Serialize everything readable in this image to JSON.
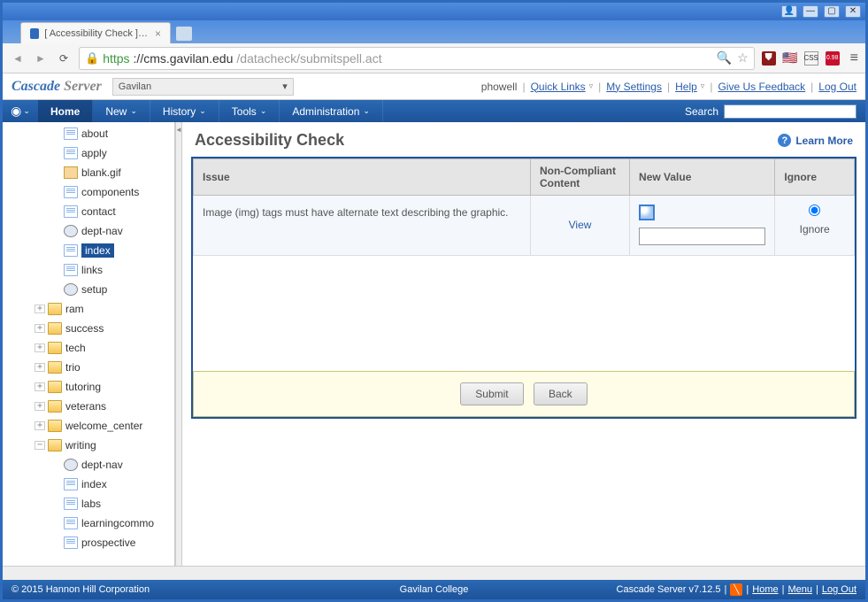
{
  "window": {
    "tab_title": "[ Accessibility Check ] Casca"
  },
  "browser": {
    "url_proto": "https",
    "url_host": "://cms.gavilan.edu",
    "url_path": "/datacheck/submitspell.act"
  },
  "logo": {
    "a": "Cascade",
    "b": " Server"
  },
  "site_selector": "Gavilan",
  "header_links": {
    "user": "phowell",
    "quick": "Quick Links",
    "settings": "My Settings",
    "help": "Help",
    "feedback": "Give Us Feedback",
    "logout": "Log Out"
  },
  "menubar": {
    "home": "Home",
    "new": "New",
    "history": "History",
    "tools": "Tools",
    "admin": "Administration",
    "search_label": "Search"
  },
  "sidebar": [
    {
      "d": 3,
      "exp": "",
      "icon": "page",
      "label": "about"
    },
    {
      "d": 3,
      "exp": "",
      "icon": "page",
      "label": "apply"
    },
    {
      "d": 3,
      "exp": "",
      "icon": "img",
      "label": "blank.gif"
    },
    {
      "d": 3,
      "exp": "",
      "icon": "page",
      "label": "components"
    },
    {
      "d": 3,
      "exp": "",
      "icon": "page",
      "label": "contact"
    },
    {
      "d": 3,
      "exp": "",
      "icon": "block",
      "label": "dept-nav"
    },
    {
      "d": 3,
      "exp": "",
      "icon": "page",
      "label": "index",
      "sel": true
    },
    {
      "d": 3,
      "exp": "",
      "icon": "page",
      "label": "links"
    },
    {
      "d": 3,
      "exp": "",
      "icon": "block",
      "label": "setup"
    },
    {
      "d": 2,
      "exp": "+",
      "icon": "folder",
      "label": "ram"
    },
    {
      "d": 2,
      "exp": "+",
      "icon": "folder",
      "label": "success"
    },
    {
      "d": 2,
      "exp": "+",
      "icon": "folder",
      "label": "tech"
    },
    {
      "d": 2,
      "exp": "+",
      "icon": "folder",
      "label": "trio"
    },
    {
      "d": 2,
      "exp": "+",
      "icon": "folder",
      "label": "tutoring"
    },
    {
      "d": 2,
      "exp": "+",
      "icon": "folder",
      "label": "veterans"
    },
    {
      "d": 2,
      "exp": "+",
      "icon": "folder",
      "label": "welcome_center"
    },
    {
      "d": 2,
      "exp": "−",
      "icon": "folder",
      "label": "writing"
    },
    {
      "d": 3,
      "exp": "",
      "icon": "block",
      "label": "dept-nav"
    },
    {
      "d": 3,
      "exp": "",
      "icon": "page",
      "label": "index"
    },
    {
      "d": 3,
      "exp": "",
      "icon": "page",
      "label": "labs"
    },
    {
      "d": 3,
      "exp": "",
      "icon": "page",
      "label": "learningcommo"
    },
    {
      "d": 3,
      "exp": "",
      "icon": "page",
      "label": "prospective"
    }
  ],
  "page": {
    "title": "Accessibility Check",
    "learn_more": "Learn More"
  },
  "table": {
    "headers": {
      "issue": "Issue",
      "content": "Non-Compliant Content",
      "newval": "New Value",
      "ignore": "Ignore"
    },
    "row": {
      "issue": "Image (img) tags must have alternate text describing the graphic.",
      "view": "View",
      "ignore": "Ignore"
    }
  },
  "buttons": {
    "submit": "Submit",
    "back": "Back"
  },
  "footer": {
    "copyright": "© 2015 Hannon Hill Corporation",
    "college": "Gavilan College",
    "version": "Cascade Server v7.12.5",
    "home": "Home",
    "menu": "Menu",
    "logout": "Log Out"
  }
}
